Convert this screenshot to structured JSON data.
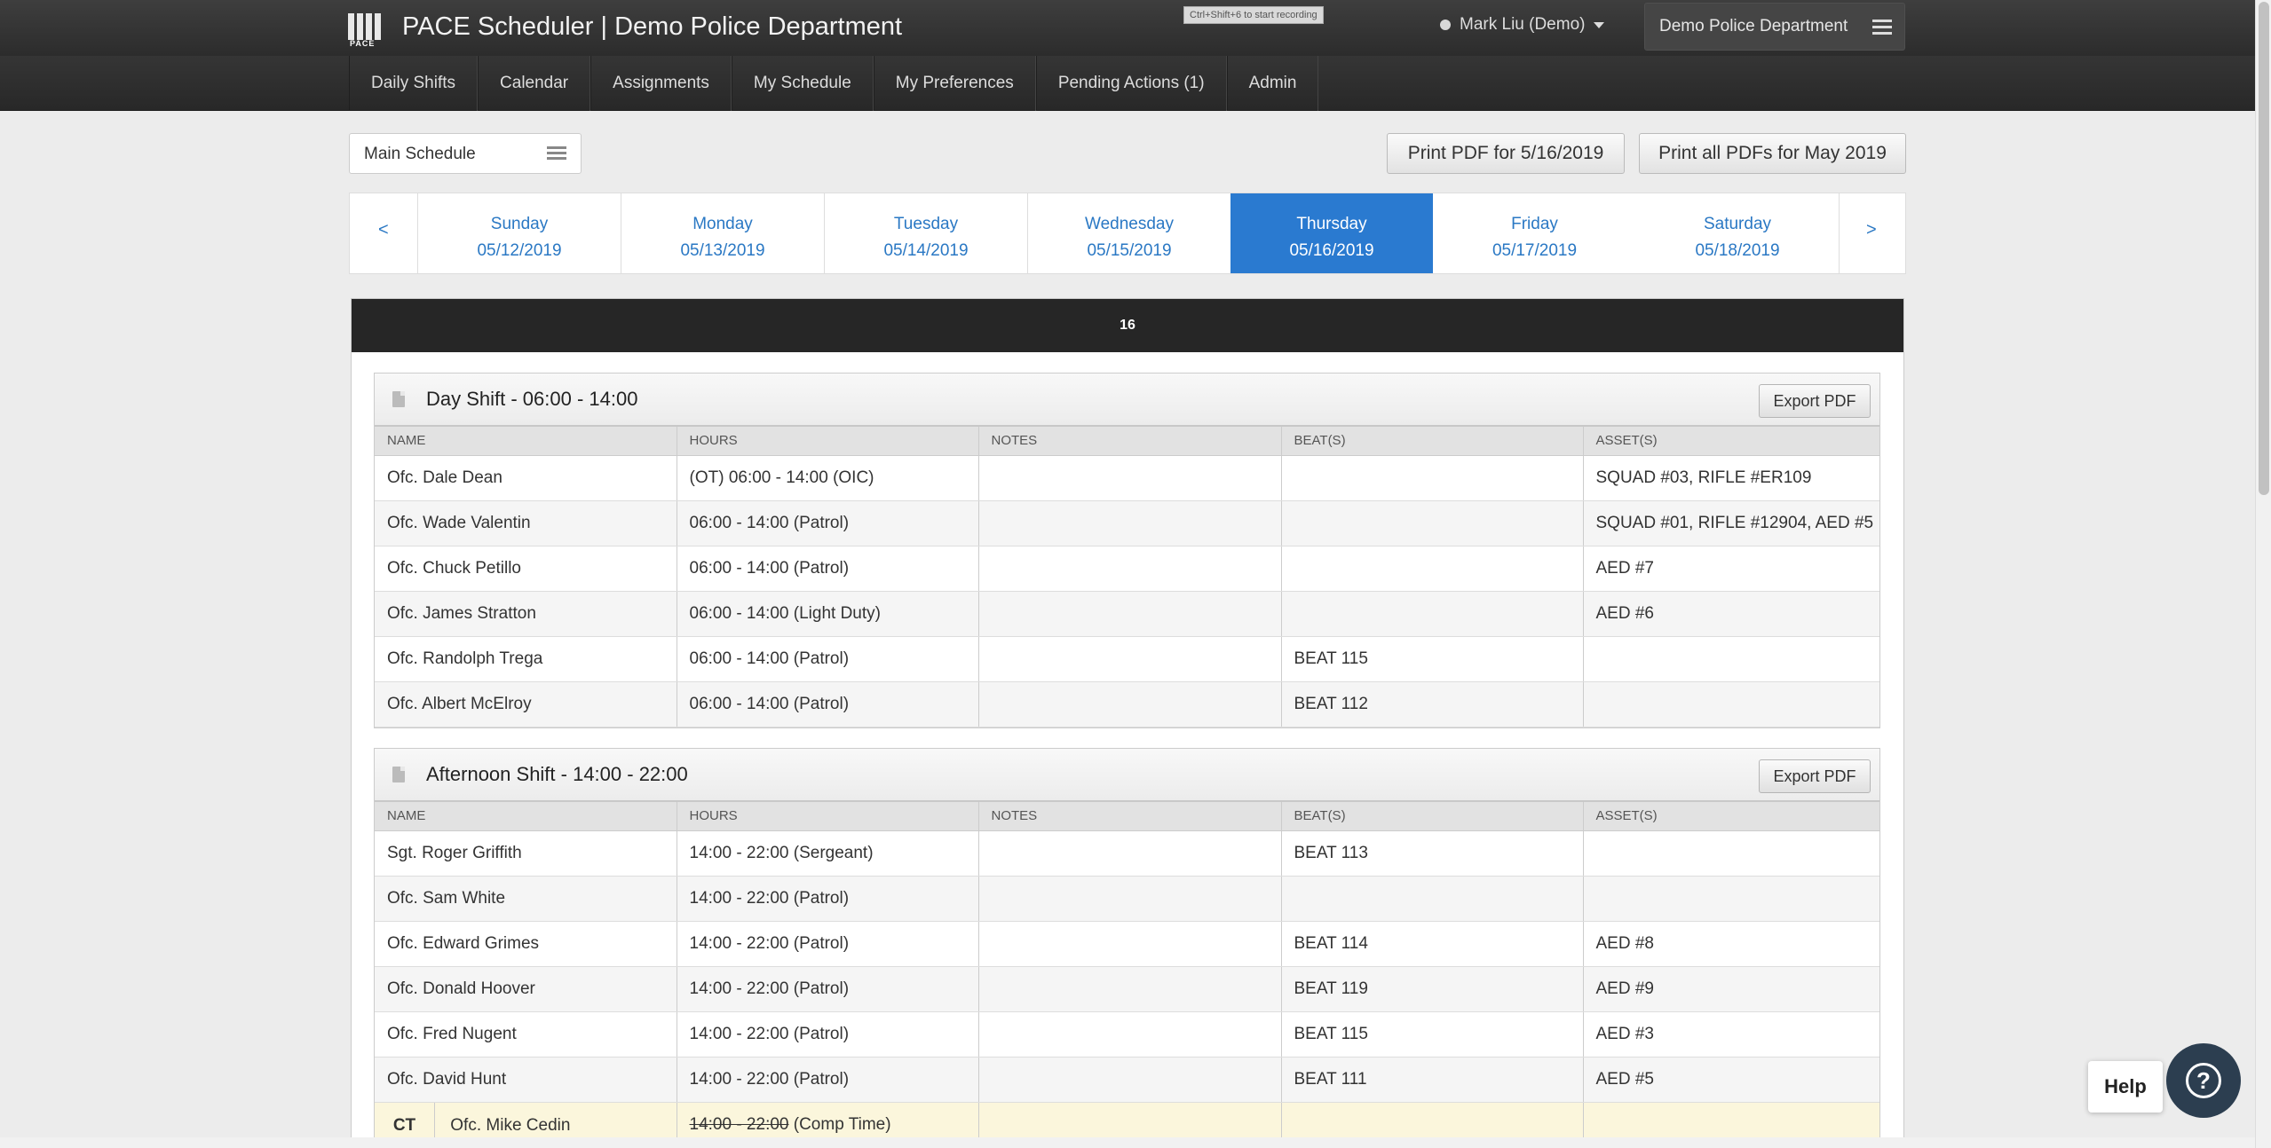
{
  "header": {
    "logo_text": "PACE",
    "title": "PACE Scheduler | Demo Police Department",
    "tooltip": "Ctrl+Shift+6 to start recording",
    "user": "Mark Liu (Demo)",
    "department": "Demo Police Department"
  },
  "nav": [
    {
      "label": "Daily Shifts"
    },
    {
      "label": "Calendar"
    },
    {
      "label": "Assignments"
    },
    {
      "label": "My Schedule"
    },
    {
      "label": "My Preferences"
    },
    {
      "label": "Pending Actions (1)"
    },
    {
      "label": "Admin"
    }
  ],
  "toolbar": {
    "schedule": "Main Schedule",
    "print_day": "Print PDF for 5/16/2019",
    "print_month": "Print all PDFs for May 2019"
  },
  "week": {
    "prev": "<",
    "next": ">",
    "days": [
      {
        "name": "Sunday",
        "date": "05/12/2019"
      },
      {
        "name": "Monday",
        "date": "05/13/2019"
      },
      {
        "name": "Tuesday",
        "date": "05/14/2019"
      },
      {
        "name": "Wednesday",
        "date": "05/15/2019"
      },
      {
        "name": "Thursday",
        "date": "05/16/2019"
      },
      {
        "name": "Friday",
        "date": "05/17/2019"
      },
      {
        "name": "Saturday",
        "date": "05/18/2019"
      }
    ],
    "active_index": 4
  },
  "panel_title": "16",
  "columns": [
    "NAME",
    "HOURS",
    "NOTES",
    "BEAT(S)",
    "ASSET(S)"
  ],
  "export_label": "Export PDF",
  "shifts": [
    {
      "title": "Day Shift - 06:00 - 14:00",
      "rows": [
        {
          "name": "Ofc. Dale Dean",
          "hours": "(OT) 06:00 - 14:00 (OIC)",
          "notes": "",
          "beats": "",
          "assets": "SQUAD #03, RIFLE #ER109"
        },
        {
          "name": "Ofc. Wade Valentin",
          "hours": "06:00 - 14:00 (Patrol)",
          "notes": "",
          "beats": "",
          "assets": "SQUAD #01, RIFLE #12904, AED #5"
        },
        {
          "name": "Ofc. Chuck Petillo",
          "hours": "06:00 - 14:00 (Patrol)",
          "notes": "",
          "beats": "",
          "assets": "AED #7"
        },
        {
          "name": "Ofc. James Stratton",
          "hours": "06:00 - 14:00 (Light Duty)",
          "notes": "",
          "beats": "",
          "assets": "AED #6"
        },
        {
          "name": "Ofc. Randolph Trega",
          "hours": "06:00 - 14:00 (Patrol)",
          "notes": "",
          "beats": "BEAT 115",
          "assets": ""
        },
        {
          "name": "Ofc. Albert McElroy",
          "hours": "06:00 - 14:00 (Patrol)",
          "notes": "",
          "beats": "BEAT 112",
          "assets": ""
        }
      ]
    },
    {
      "title": "Afternoon Shift - 14:00 - 22:00",
      "rows": [
        {
          "name": "Sgt. Roger Griffith",
          "hours": "14:00 - 22:00 (Sergeant)",
          "notes": "",
          "beats": "BEAT 113",
          "assets": ""
        },
        {
          "name": "Ofc. Sam White",
          "hours": "14:00 - 22:00 (Patrol)",
          "notes": "",
          "beats": "",
          "assets": ""
        },
        {
          "name": "Ofc. Edward Grimes",
          "hours": "14:00 - 22:00 (Patrol)",
          "notes": "",
          "beats": "BEAT 114",
          "assets": "AED #8"
        },
        {
          "name": "Ofc. Donald Hoover",
          "hours": "14:00 - 22:00 (Patrol)",
          "notes": "",
          "beats": "BEAT 119",
          "assets": "AED #9"
        },
        {
          "name": "Ofc. Fred Nugent",
          "hours": "14:00 - 22:00 (Patrol)",
          "notes": "",
          "beats": "BEAT 115",
          "assets": "AED #3"
        },
        {
          "name": "Ofc. David Hunt",
          "hours": "14:00 - 22:00 (Patrol)",
          "notes": "",
          "beats": "BEAT 111",
          "assets": "AED #5"
        }
      ],
      "comp_row": {
        "tag": "CT",
        "name": "Ofc. Mike Cedin",
        "hours_struck": "14:00 - 22:00",
        "hours_note": " (Comp Time)"
      }
    }
  ],
  "help": {
    "label": "Help",
    "icon": "?"
  }
}
